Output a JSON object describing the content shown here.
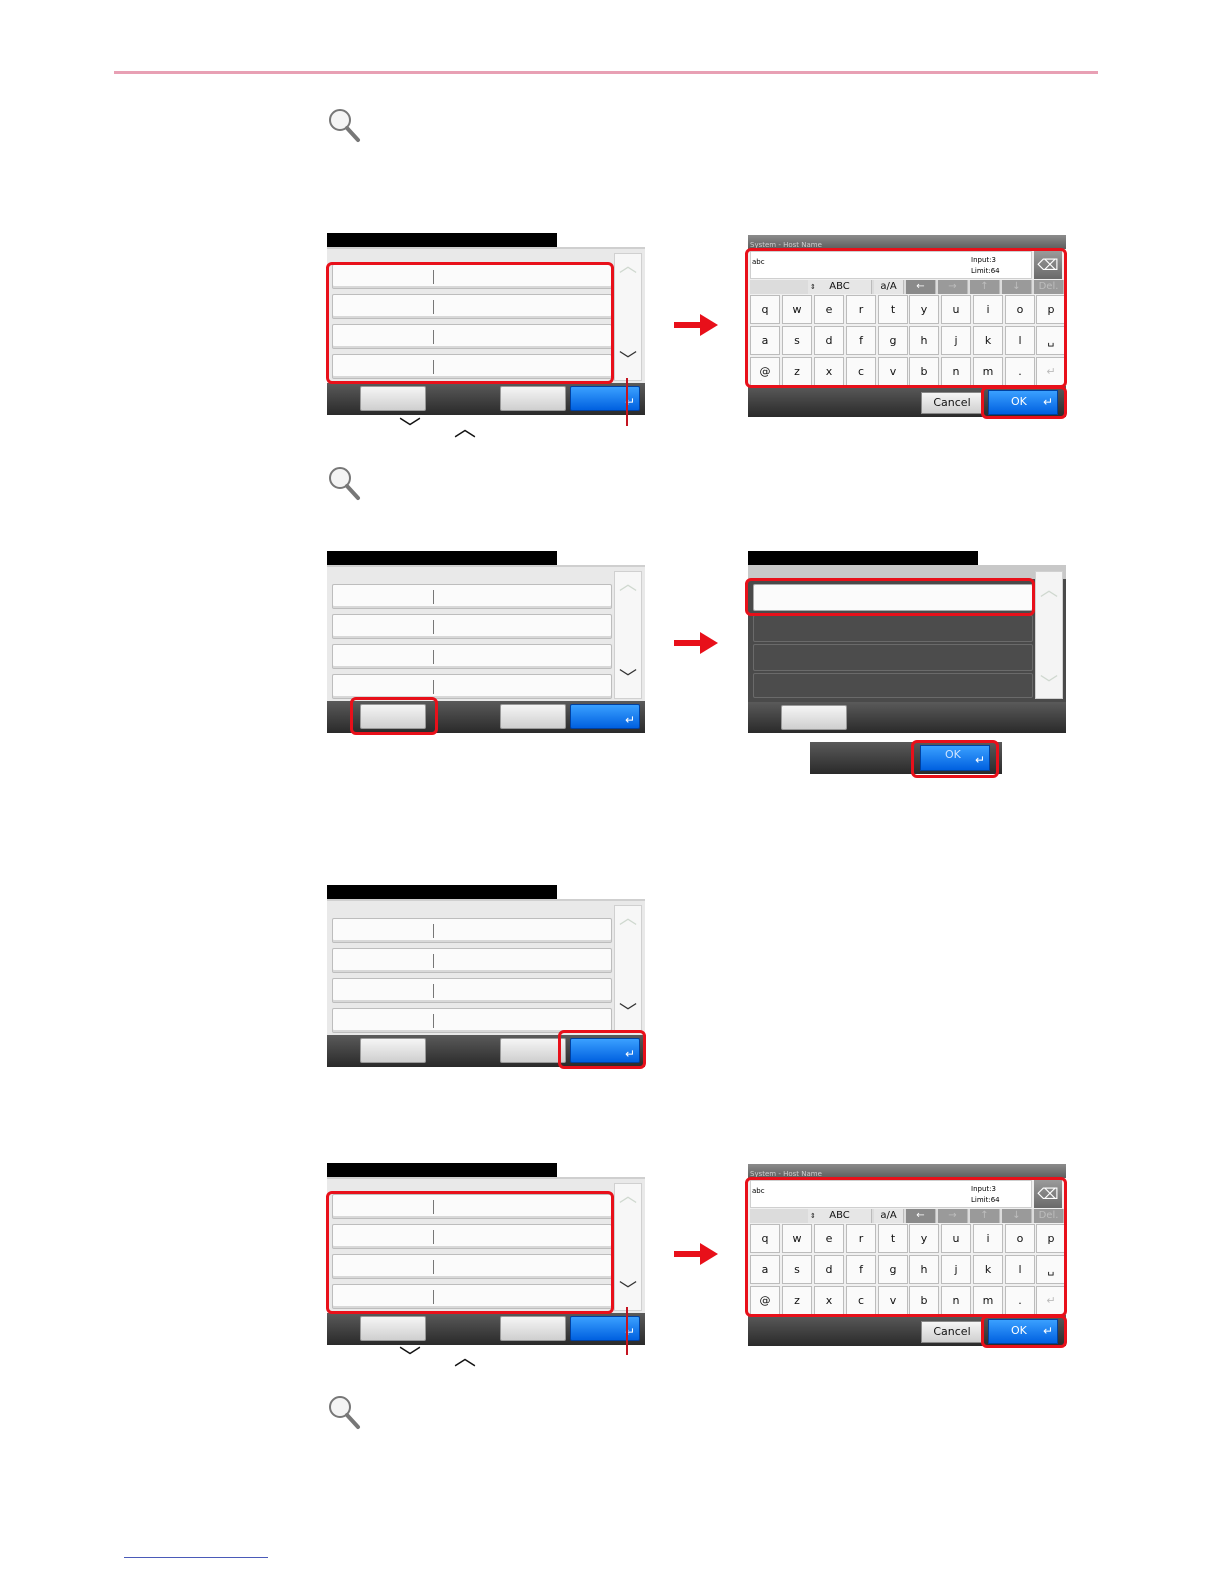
{
  "keyboard": {
    "title": "System - Host Name",
    "input_value": "abc",
    "input_count_line1": "Input:3",
    "input_count_line2": "Limit:64",
    "backspace_icon": "backspace-icon",
    "mode_abc": "ABC",
    "mode_case": "a/A",
    "del_label": "Del.",
    "row1": [
      "q",
      "w",
      "e",
      "r",
      "t",
      "y",
      "u",
      "i",
      "o",
      "p"
    ],
    "row2": [
      "a",
      "s",
      "d",
      "f",
      "g",
      "h",
      "j",
      "k",
      "l"
    ],
    "row3": [
      "@",
      "z",
      "x",
      "c",
      "v",
      "b",
      "n",
      "m",
      "."
    ],
    "cancel_label": "Cancel",
    "ok_label": "OK"
  },
  "popup": {
    "ok_label": "OK"
  },
  "colors": {
    "highlight": "#e8101a",
    "accent_blue": "#0060e0",
    "rule": "#e8a0b4"
  }
}
